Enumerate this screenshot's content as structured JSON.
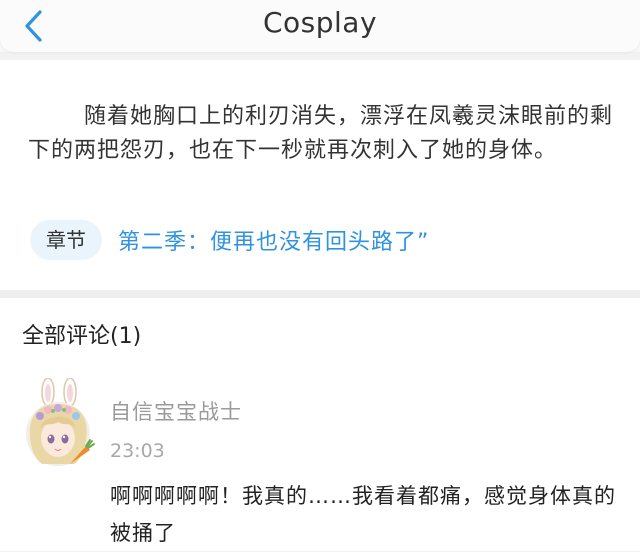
{
  "header": {
    "title": "Cosplay",
    "back_icon": "chevron-left-icon",
    "accent_color": "#2f93e0"
  },
  "excerpt": {
    "text": "随着她胸口上的利刃消失，漂浮在凤羲灵沫眼前的剩下的两把怨刃，也在下一秒就再次刺入了她的身体。"
  },
  "chapter": {
    "tag_label": "章节",
    "title": "第二季：便再也没有回头路了”"
  },
  "comments": {
    "header": "全部评论(1)",
    "items": [
      {
        "username": "自信宝宝战士",
        "time": "23:03",
        "text": "啊啊啊啊啊！我真的……我看着都痛，感觉身体真的被捅了",
        "avatar_icon": "anime-girl-bunny-ears-avatar"
      }
    ]
  }
}
